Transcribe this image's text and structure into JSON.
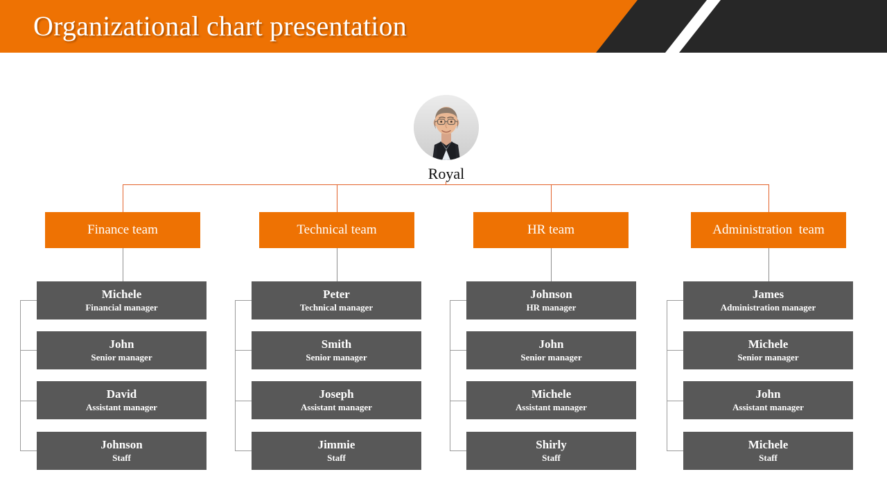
{
  "header": {
    "title": "Organizational chart presentation",
    "orange": "#ee7203",
    "dark": "#272727",
    "title_color": "#ffffff"
  },
  "theme": {
    "accent": "#ee7203",
    "connector_accent": "#e2622a",
    "connector_gray": "#9a9a9a",
    "box_gray": "#585858",
    "background": "#ffffff"
  },
  "root": {
    "name": "Royal",
    "avatar_icon": "person-photo-avatar"
  },
  "columns": [
    {
      "team": "Finance team",
      "members": [
        {
          "name": "Michele",
          "role": "Financial manager"
        },
        {
          "name": "John",
          "role": "Senior manager"
        },
        {
          "name": "David",
          "role": "Assistant manager"
        },
        {
          "name": "Johnson",
          "role": "Staff"
        }
      ]
    },
    {
      "team": "Technical team",
      "members": [
        {
          "name": "Peter",
          "role": "Technical manager"
        },
        {
          "name": "Smith",
          "role": "Senior manager"
        },
        {
          "name": "Joseph",
          "role": "Assistant manager"
        },
        {
          "name": "Jimmie",
          "role": "Staff"
        }
      ]
    },
    {
      "team": "HR team",
      "members": [
        {
          "name": "Johnson",
          "role": "HR manager"
        },
        {
          "name": "John",
          "role": "Senior manager"
        },
        {
          "name": "Michele",
          "role": "Assistant manager"
        },
        {
          "name": "Shirly",
          "role": "Staff"
        }
      ]
    },
    {
      "team": "Administration  team",
      "members": [
        {
          "name": "James",
          "role": "Administration manager"
        },
        {
          "name": "Michele",
          "role": "Senior manager"
        },
        {
          "name": "John",
          "role": "Assistant manager"
        },
        {
          "name": "Michele",
          "role": "Staff"
        }
      ]
    }
  ]
}
